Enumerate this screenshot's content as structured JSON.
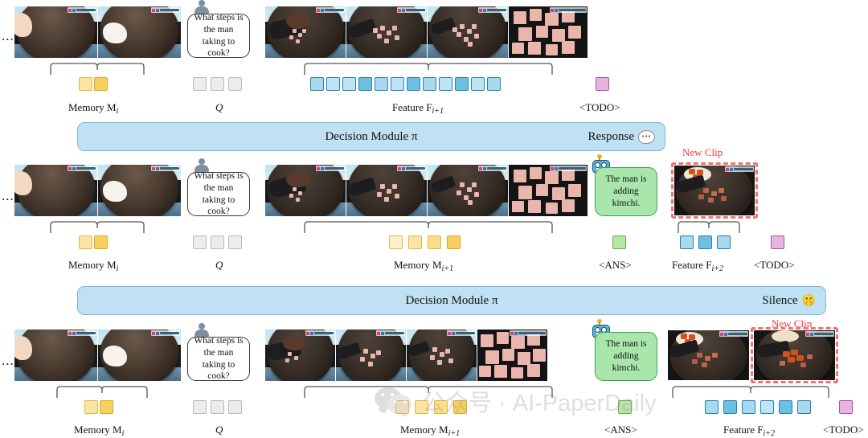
{
  "figure": {
    "title": "Streaming video decision module pipeline",
    "watermark": {
      "text": "公众号 · AI-PaperDaily",
      "icon": "wechat-icon"
    }
  },
  "colors": {
    "memory_token": "#f7cf5e",
    "query_token": "#ececec",
    "feature_token": "#6cc0e3",
    "ans_token": "#b6e6a3",
    "todo_token": "#e7b3e1",
    "decision_bar": "#bfe1f3",
    "new_clip_accent": "#ef3a3a"
  },
  "question": {
    "text": "What steps is the man taking to cook?",
    "speaker_icon": "user-avatar-icon"
  },
  "answer": {
    "text": "The man is adding kimchi.",
    "speaker_icon": "robot-avatar-icon"
  },
  "labels": {
    "memory_i": "Memory M",
    "memory_i_sub": "i",
    "memory_i1": "Memory M",
    "memory_i1_sub": "i+1",
    "query": "Q",
    "feature_i1": "Feature F",
    "feature_i1_sub": "i+1",
    "feature_i2": "Feature F",
    "feature_i2_sub": "i+2",
    "todo": "<TODO>",
    "ans": "<ANS>",
    "new_clip": "New Clip",
    "ellipsis": "..."
  },
  "decision_bars": [
    {
      "label": "Decision Module π",
      "outcome": "Response",
      "outcome_icon": "speech-bubble-icon"
    },
    {
      "label": "Decision Module π",
      "outcome": "Silence",
      "outcome_icon": "shushing-face-emoji"
    }
  ],
  "rows": [
    {
      "id": "row-1",
      "memory_tokens": 2,
      "query_tokens": 3,
      "feature_tokens": 12,
      "todo_tokens": 1,
      "ans_tokens": 0,
      "has_answer_bubble": false,
      "has_new_clip": false
    },
    {
      "id": "row-2",
      "memory_tokens": 2,
      "query_tokens": 3,
      "memory_next_tokens": 4,
      "feature_tokens": 3,
      "todo_tokens": 1,
      "ans_tokens": 1,
      "has_answer_bubble": true,
      "has_new_clip": true
    },
    {
      "id": "row-3",
      "memory_tokens": 2,
      "query_tokens": 3,
      "memory_next_tokens": 4,
      "feature_tokens": 6,
      "todo_tokens": 1,
      "ans_tokens": 1,
      "has_answer_bubble": true,
      "has_new_clip": true
    }
  ]
}
